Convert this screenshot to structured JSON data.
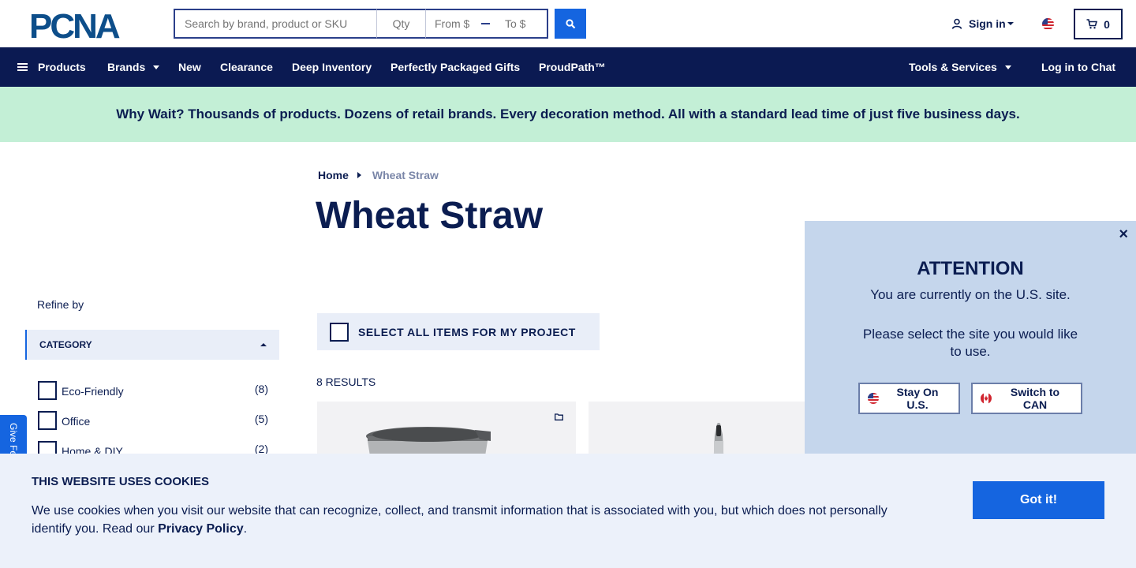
{
  "header": {
    "logo_text": "PCNA",
    "search": {
      "placeholder": "Search by brand, product or SKU",
      "value": ""
    },
    "qty": {
      "placeholder": "Qty"
    },
    "price_from": {
      "placeholder": "From $"
    },
    "price_to": {
      "placeholder": "To $"
    },
    "sign_in_label": "Sign in",
    "cart_count": "0"
  },
  "nav": {
    "products": "Products",
    "brands": "Brands",
    "new": "New",
    "clearance": "Clearance",
    "deep_inventory": "Deep Inventory",
    "perfectly_packaged_gifts": "Perfectly Packaged Gifts",
    "proudpath": "ProudPath™",
    "tools_services": "Tools & Services",
    "log_in_chat": "Log in to Chat"
  },
  "promo": {
    "text": "Why Wait? Thousands of products. Dozens of retail brands. Every decoration method. All with a standard lead time of just five business days."
  },
  "breadcrumb": {
    "home": "Home",
    "current": "Wheat Straw"
  },
  "page_title": "Wheat Straw",
  "sidebar": {
    "refine_label": "Refine by",
    "category_header": "CATEGORY",
    "filters": [
      {
        "label": "Eco-Friendly",
        "count": "(8)"
      },
      {
        "label": "Office",
        "count": "(5)"
      },
      {
        "label": "Home & DIY",
        "count": "(2)"
      }
    ],
    "feedback_label": "Give Feedback"
  },
  "main": {
    "select_all_label": "SELECT ALL ITEMS FOR MY PROJECT",
    "results_count": "8 RESULTS"
  },
  "popup": {
    "title": "ATTENTION",
    "line1": "You are currently on the U.S. site.",
    "line2": "Please select the site you would like to use.",
    "stay_label": "Stay On U.S.",
    "switch_label": "Switch to CAN",
    "close": "×"
  },
  "cookie": {
    "title": "THIS WEBSITE USES COOKIES",
    "text_before": "We use cookies when you visit our website that can recognize, collect, and transmit information that is associated with you, but which does not personally identify you. Read our ",
    "link": "Privacy Policy",
    "text_after": ".",
    "button": "Got it!"
  },
  "colors": {
    "navy": "#0b1a52",
    "accent_blue": "#1565e0",
    "promo_green": "#c3efd6",
    "popup_bg": "#c5d6ec",
    "cookie_bg": "#ecf1fa"
  },
  "icons": [
    "pcna-logo",
    "search-icon",
    "user-icon",
    "us-flag-icon",
    "cart-icon",
    "hamburger-icon",
    "chevron-down-icon",
    "folder-icon",
    "close-icon",
    "canada-flag-icon"
  ]
}
